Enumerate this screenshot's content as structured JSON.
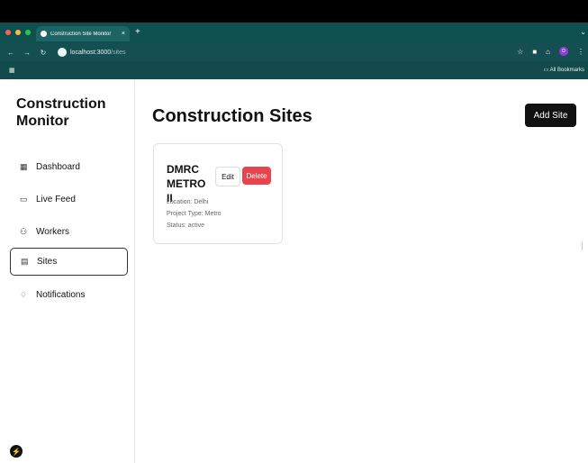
{
  "browser": {
    "tab_title": "Construction Site Monitor",
    "tab_close": "×",
    "new_tab": "+",
    "dropdown": "⌄",
    "url_host": "localhost:3000",
    "url_path": "/sites",
    "profile_initial": "D",
    "bookmarks_label": "All Bookmarks",
    "dot_colors": [
      "#ff5f57",
      "#febc2e",
      "#28c840"
    ]
  },
  "sidebar": {
    "app_title": "Construction Monitor",
    "items": [
      {
        "label": "Dashboard",
        "icon": "grid-icon"
      },
      {
        "label": "Live Feed",
        "icon": "camera-icon"
      },
      {
        "label": "Workers",
        "icon": "users-icon"
      },
      {
        "label": "Sites",
        "icon": "building-icon",
        "active": true
      },
      {
        "label": "Notifications",
        "icon": "bell-icon"
      }
    ]
  },
  "main": {
    "title": "Construction Sites",
    "add_button": "Add Site",
    "sites": [
      {
        "name": "DMRC METRO II",
        "edit_label": "Edit",
        "delete_label": "Delete",
        "location": "Location: Delhi",
        "project_type": "Project Type: Metro",
        "status": "Status: active"
      }
    ]
  },
  "colors": {
    "tab_bar": "#0e4f4f",
    "delete": "#e7454b",
    "primary_button": "#111111"
  }
}
